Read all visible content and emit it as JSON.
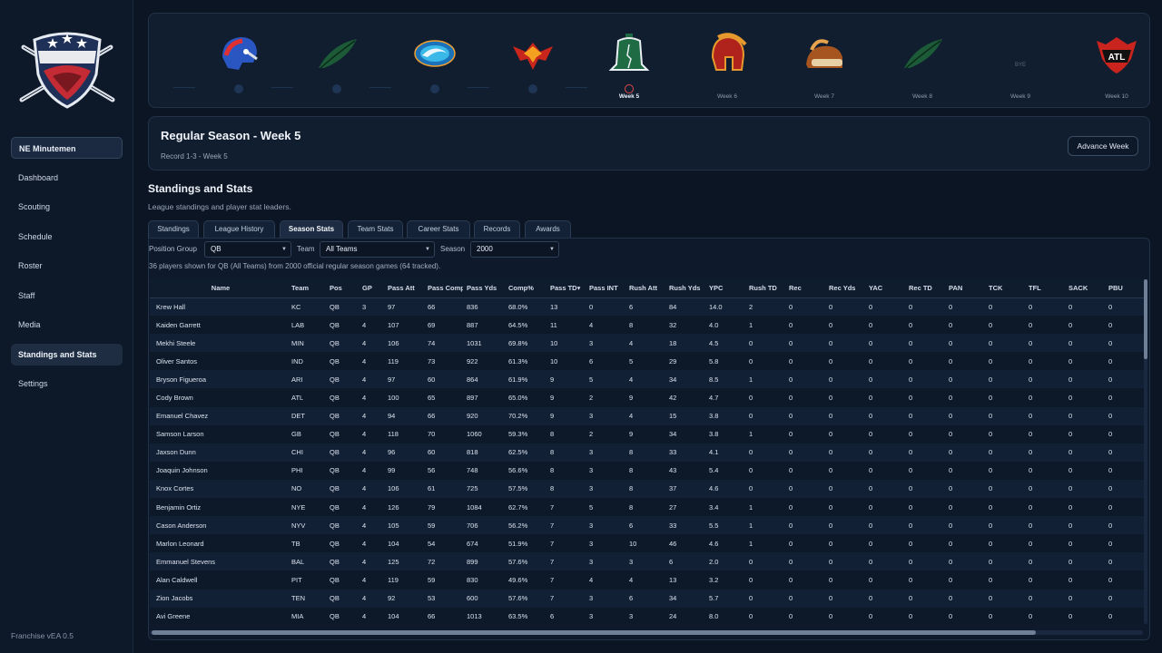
{
  "sidebar": {
    "team": "NE Minutemen",
    "items": [
      {
        "label": "Dashboard",
        "key": "dashboard"
      },
      {
        "label": "Scouting",
        "key": "scouting"
      },
      {
        "label": "Schedule",
        "key": "schedule"
      },
      {
        "label": "Roster",
        "key": "roster"
      },
      {
        "label": "Staff",
        "key": "staff"
      },
      {
        "label": "Media",
        "key": "media"
      },
      {
        "label": "Standings and Stats",
        "key": "standings-and-stats",
        "active": true
      },
      {
        "label": "Settings",
        "key": "settings"
      }
    ],
    "version": "Franchise vEA 0.5"
  },
  "weeks": [
    {
      "label": "",
      "state": "past",
      "icon": "patriot-helmet-icon"
    },
    {
      "label": "",
      "state": "past",
      "icon": "feather-icon"
    },
    {
      "label": "",
      "state": "past",
      "icon": "wave-icon"
    },
    {
      "label": "",
      "state": "past",
      "icon": "phoenix-icon"
    },
    {
      "label": "Week 5",
      "state": "current",
      "icon": "liberty-bell-icon"
    },
    {
      "label": "Week 6",
      "state": "future",
      "icon": "spartan-helmet-icon"
    },
    {
      "label": "Week 7",
      "state": "future",
      "icon": "bison-icon"
    },
    {
      "label": "Week 8",
      "state": "future",
      "icon": "feather-icon"
    },
    {
      "label": "Week 9",
      "state": "bye",
      "icon": "",
      "bye_text": "BYE"
    },
    {
      "label": "Week 10",
      "state": "future",
      "icon": "atl-shield-icon",
      "icon_text": "ATL"
    }
  ],
  "season": {
    "title": "Regular Season - Week 5",
    "record": "Record 1-3 - Week 5",
    "advance_label": "Advance Week"
  },
  "section": {
    "title": "Standings and Stats",
    "subtitle": "League standings and player stat leaders."
  },
  "tabs": [
    {
      "label": "Standings"
    },
    {
      "label": "League History"
    },
    {
      "label": "Season Stats",
      "active": true
    },
    {
      "label": "Team Stats"
    },
    {
      "label": "Career Stats"
    },
    {
      "label": "Records"
    },
    {
      "label": "Awards"
    }
  ],
  "filters": {
    "position_label": "Position Group",
    "position_value": "QB",
    "team_label": "Team",
    "team_value": "All Teams",
    "season_label": "Season",
    "season_value": "2000"
  },
  "summary": "36 players shown for QB (All Teams) from 2000 official regular season games (64 tracked).",
  "table": {
    "columns": [
      "Name",
      "Team",
      "Pos",
      "GP",
      "Pass Att",
      "Pass Comp",
      "Pass Yds",
      "Comp%",
      "Pass TD▾",
      "Pass INT",
      "Rush Att",
      "Rush Yds",
      "YPC",
      "Rush TD",
      "Rec",
      "Rec Yds",
      "YAC",
      "Rec TD",
      "PAN",
      "TCK",
      "TFL",
      "SACK",
      "PBU"
    ],
    "rows": [
      [
        "Krew Hall",
        "KC",
        "QB",
        "3",
        "97",
        "66",
        "836",
        "68.0%",
        "13",
        "0",
        "6",
        "84",
        "14.0",
        "2",
        "0",
        "0",
        "0",
        "0",
        "0",
        "0",
        "0",
        "0",
        "0"
      ],
      [
        "Kaiden Garrett",
        "LAB",
        "QB",
        "4",
        "107",
        "69",
        "887",
        "64.5%",
        "11",
        "4",
        "8",
        "32",
        "4.0",
        "1",
        "0",
        "0",
        "0",
        "0",
        "0",
        "0",
        "0",
        "0",
        "0"
      ],
      [
        "Mekhi Steele",
        "MIN",
        "QB",
        "4",
        "106",
        "74",
        "1031",
        "69.8%",
        "10",
        "3",
        "4",
        "18",
        "4.5",
        "0",
        "0",
        "0",
        "0",
        "0",
        "0",
        "0",
        "0",
        "0",
        "0"
      ],
      [
        "Oliver Santos",
        "IND",
        "QB",
        "4",
        "119",
        "73",
        "922",
        "61.3%",
        "10",
        "6",
        "5",
        "29",
        "5.8",
        "0",
        "0",
        "0",
        "0",
        "0",
        "0",
        "0",
        "0",
        "0",
        "0"
      ],
      [
        "Bryson Figueroa",
        "ARI",
        "QB",
        "4",
        "97",
        "60",
        "864",
        "61.9%",
        "9",
        "5",
        "4",
        "34",
        "8.5",
        "1",
        "0",
        "0",
        "0",
        "0",
        "0",
        "0",
        "0",
        "0",
        "0"
      ],
      [
        "Cody Brown",
        "ATL",
        "QB",
        "4",
        "100",
        "65",
        "897",
        "65.0%",
        "9",
        "2",
        "9",
        "42",
        "4.7",
        "0",
        "0",
        "0",
        "0",
        "0",
        "0",
        "0",
        "0",
        "0",
        "0"
      ],
      [
        "Emanuel Chavez",
        "DET",
        "QB",
        "4",
        "94",
        "66",
        "920",
        "70.2%",
        "9",
        "3",
        "4",
        "15",
        "3.8",
        "0",
        "0",
        "0",
        "0",
        "0",
        "0",
        "0",
        "0",
        "0",
        "0"
      ],
      [
        "Samson Larson",
        "GB",
        "QB",
        "4",
        "118",
        "70",
        "1060",
        "59.3%",
        "8",
        "2",
        "9",
        "34",
        "3.8",
        "1",
        "0",
        "0",
        "0",
        "0",
        "0",
        "0",
        "0",
        "0",
        "0"
      ],
      [
        "Jaxson Dunn",
        "CHI",
        "QB",
        "4",
        "96",
        "60",
        "818",
        "62.5%",
        "8",
        "3",
        "8",
        "33",
        "4.1",
        "0",
        "0",
        "0",
        "0",
        "0",
        "0",
        "0",
        "0",
        "0",
        "0"
      ],
      [
        "Joaquin Johnson",
        "PHI",
        "QB",
        "4",
        "99",
        "56",
        "748",
        "56.6%",
        "8",
        "3",
        "8",
        "43",
        "5.4",
        "0",
        "0",
        "0",
        "0",
        "0",
        "0",
        "0",
        "0",
        "0",
        "0"
      ],
      [
        "Knox Cortes",
        "NO",
        "QB",
        "4",
        "106",
        "61",
        "725",
        "57.5%",
        "8",
        "3",
        "8",
        "37",
        "4.6",
        "0",
        "0",
        "0",
        "0",
        "0",
        "0",
        "0",
        "0",
        "0",
        "0"
      ],
      [
        "Benjamin Ortiz",
        "NYE",
        "QB",
        "4",
        "126",
        "79",
        "1084",
        "62.7%",
        "7",
        "5",
        "8",
        "27",
        "3.4",
        "1",
        "0",
        "0",
        "0",
        "0",
        "0",
        "0",
        "0",
        "0",
        "0"
      ],
      [
        "Cason Anderson",
        "NYV",
        "QB",
        "4",
        "105",
        "59",
        "706",
        "56.2%",
        "7",
        "3",
        "6",
        "33",
        "5.5",
        "1",
        "0",
        "0",
        "0",
        "0",
        "0",
        "0",
        "0",
        "0",
        "0"
      ],
      [
        "Marlon Leonard",
        "TB",
        "QB",
        "4",
        "104",
        "54",
        "674",
        "51.9%",
        "7",
        "3",
        "10",
        "46",
        "4.6",
        "1",
        "0",
        "0",
        "0",
        "0",
        "0",
        "0",
        "0",
        "0",
        "0"
      ],
      [
        "Emmanuel Stevens",
        "BAL",
        "QB",
        "4",
        "125",
        "72",
        "899",
        "57.6%",
        "7",
        "3",
        "3",
        "6",
        "2.0",
        "0",
        "0",
        "0",
        "0",
        "0",
        "0",
        "0",
        "0",
        "0",
        "0"
      ],
      [
        "Alan Caldwell",
        "PIT",
        "QB",
        "4",
        "119",
        "59",
        "830",
        "49.6%",
        "7",
        "4",
        "4",
        "13",
        "3.2",
        "0",
        "0",
        "0",
        "0",
        "0",
        "0",
        "0",
        "0",
        "0",
        "0"
      ],
      [
        "Zion Jacobs",
        "TEN",
        "QB",
        "4",
        "92",
        "53",
        "600",
        "57.6%",
        "7",
        "3",
        "6",
        "34",
        "5.7",
        "0",
        "0",
        "0",
        "0",
        "0",
        "0",
        "0",
        "0",
        "0",
        "0"
      ],
      [
        "Avi Greene",
        "MIA",
        "QB",
        "4",
        "104",
        "66",
        "1013",
        "63.5%",
        "6",
        "3",
        "3",
        "24",
        "8.0",
        "0",
        "0",
        "0",
        "0",
        "0",
        "0",
        "0",
        "0",
        "0",
        "0"
      ]
    ]
  },
  "colors": {
    "background": "#0b1524",
    "panel": "#111e30",
    "accent_red": "#e04848",
    "logo_red": "#c42b35",
    "logo_navy": "#1e2f58"
  }
}
